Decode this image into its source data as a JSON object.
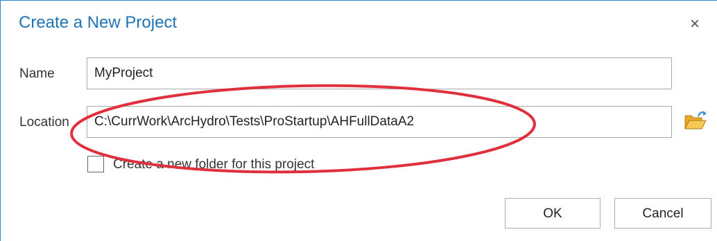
{
  "dialog": {
    "title": "Create a New Project",
    "close_symbol": "×"
  },
  "form": {
    "name_label": "Name",
    "name_value": "MyProject",
    "location_label": "Location",
    "location_value": "C:\\CurrWork\\ArcHydro\\Tests\\ProStartup\\AHFullDataA2",
    "checkbox_label": "Create a new folder for this project",
    "checkbox_checked": false
  },
  "buttons": {
    "ok_label": "OK",
    "cancel_label": "Cancel"
  },
  "icons": {
    "close": "close-icon",
    "browse": "open-folder-icon"
  },
  "colors": {
    "title": "#1f73b7",
    "annotation": "#e0303b",
    "folder": "#f2b632"
  }
}
